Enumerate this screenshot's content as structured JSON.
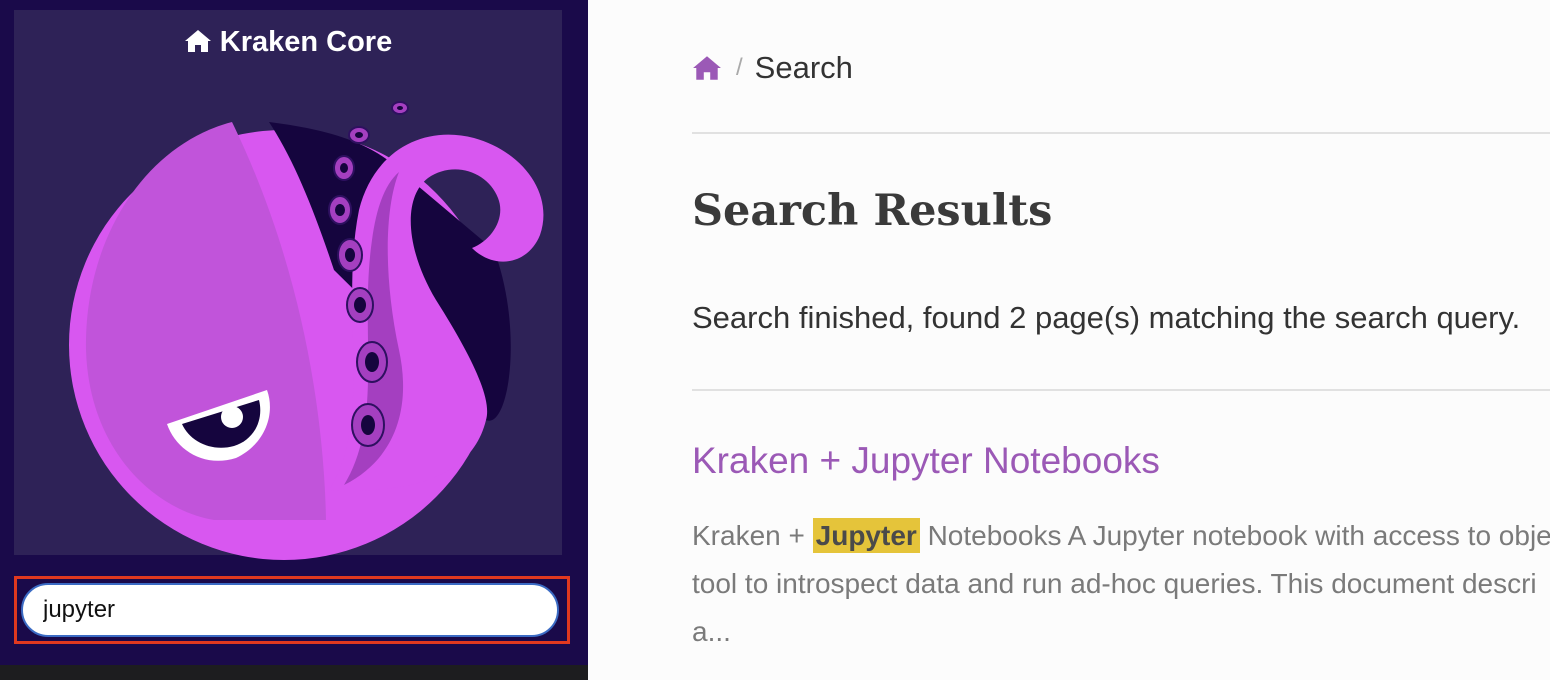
{
  "sidebar": {
    "project_name": "Kraken Core",
    "logo_name": "kraken-octopus-logo",
    "search": {
      "value": "jupyter",
      "placeholder": ""
    }
  },
  "breadcrumb": {
    "home_icon": "home-icon",
    "separator": "/",
    "current": "Search"
  },
  "main": {
    "title": "Search Results",
    "summary": "Search finished, found 2 page(s) matching the search query.",
    "results": [
      {
        "title": "Kraken + Jupyter Notebooks",
        "snippet_pre": "Kraken + ",
        "snippet_highlight": "Jupyter",
        "snippet_line1_rest": " Notebooks A Jupyter notebook with access to obje",
        "snippet_line2": "tool to introspect data and run ad-hoc queries. This document descri",
        "snippet_line3": "a..."
      }
    ]
  },
  "colors": {
    "sidebar_bg": "#1a0a4a",
    "logo_panel_bg": "#2e2257",
    "accent_purple": "#9b59b6",
    "logo_magenta": "#d857f0",
    "highlight": "#e5c43a",
    "focus_outline": "#e0391f"
  }
}
